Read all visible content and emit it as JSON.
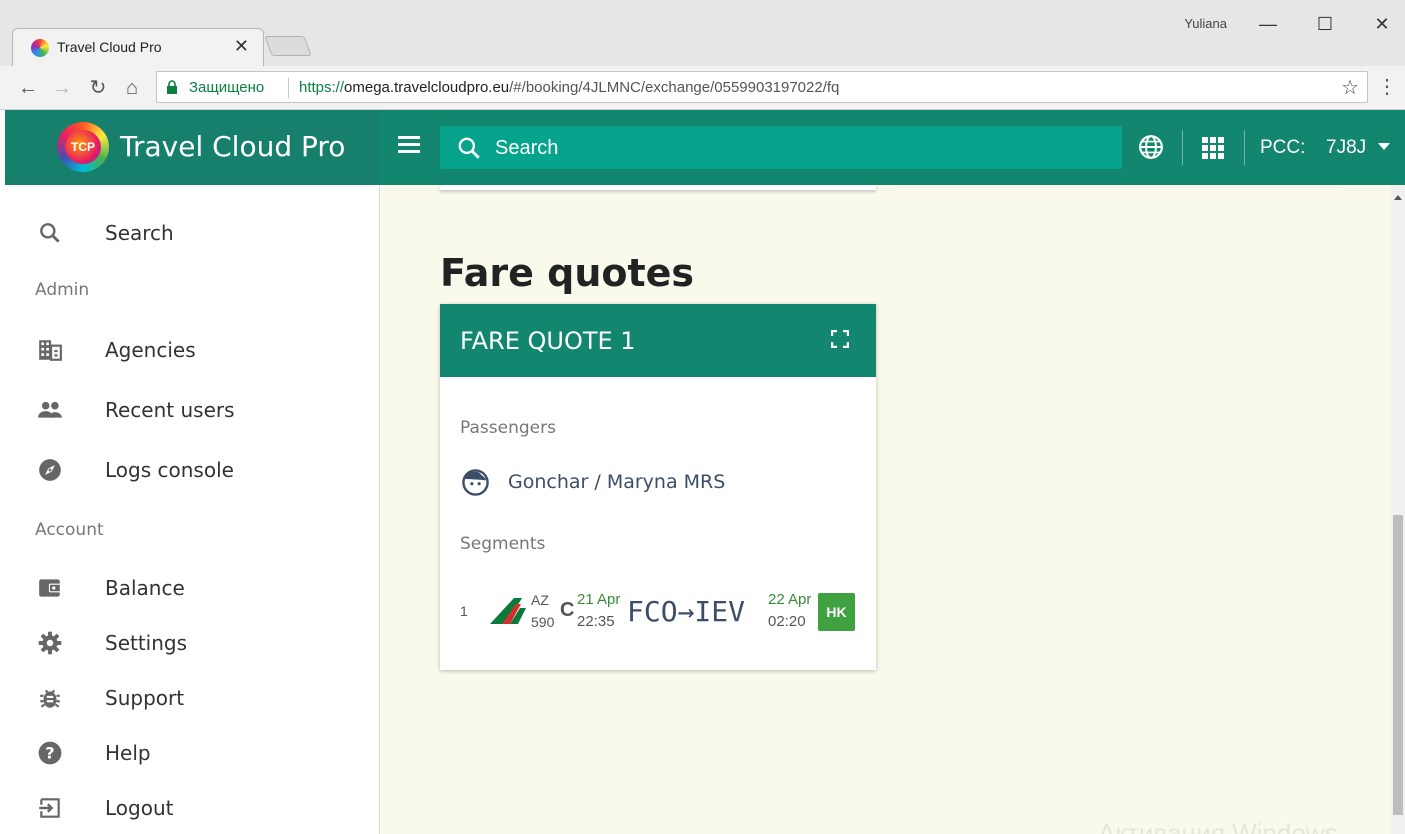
{
  "browser": {
    "tab_title": "Travel Cloud Pro",
    "tab_close": "✕",
    "user": "Yuliana",
    "secure_label": "Защищено",
    "url_scheme": "https://",
    "url_host": "omega.travelcloudpro.eu",
    "url_path": "/#/booking/4JLMNC/exchange/0559903197022/fq",
    "minimize": "—",
    "maximize": "☐",
    "close": "✕"
  },
  "app": {
    "brand": "Travel Cloud Pro",
    "logo_text": "TCP",
    "search_placeholder": "Search",
    "pcc_label": "PCC:",
    "pcc_value": "7J8J"
  },
  "sidebar": {
    "search": "Search",
    "admin_heading": "Admin",
    "agencies": "Agencies",
    "recent_users": "Recent users",
    "logs_console": "Logs console",
    "account_heading": "Account",
    "balance": "Balance",
    "settings": "Settings",
    "support": "Support",
    "help": "Help",
    "logout": "Logout"
  },
  "main": {
    "section_title": "Fare quotes",
    "card": {
      "title": "FARE QUOTE 1",
      "passengers_label": "Passengers",
      "passenger_name": "Gonchar / Maryna MRS",
      "segments_label": "Segments",
      "segment": {
        "number": "1",
        "carrier": "AZ",
        "flight_number": "590",
        "cabin": "C",
        "dep_date": "21 Apr",
        "dep_time": "22:35",
        "route": "FCO→IEV",
        "arr_date": "22 Apr",
        "arr_time": "02:20",
        "status": "HK"
      }
    }
  },
  "watermark": "Активация Windows",
  "colors": {
    "brand_teal": "#16806c",
    "search_teal": "#06a48c",
    "content_bg": "#f9faeb",
    "status_green": "#3fa13f"
  }
}
